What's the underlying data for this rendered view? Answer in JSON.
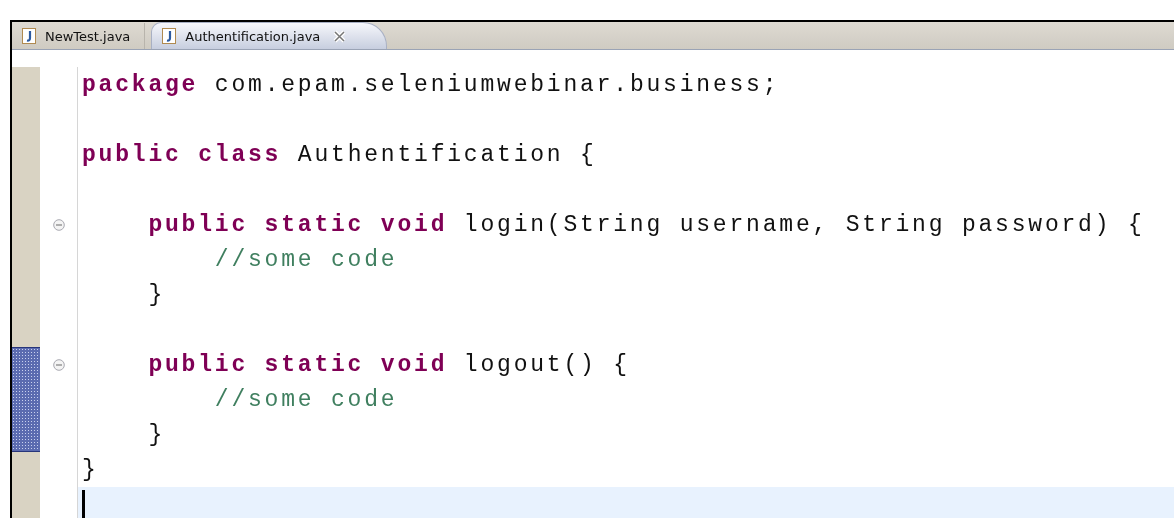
{
  "tabs": [
    {
      "label": "NewTest.java",
      "selected": false
    },
    {
      "label": "Authentification.java",
      "selected": true
    }
  ],
  "lines": [
    {
      "kind": "code",
      "tokens": [
        {
          "kind": "keyword",
          "text": "package"
        },
        {
          "kind": "plain",
          "text": " com.epam.seleniumwebinar.business;"
        }
      ]
    },
    {
      "kind": "blank"
    },
    {
      "kind": "code",
      "tokens": [
        {
          "kind": "keyword",
          "text": "public class"
        },
        {
          "kind": "plain",
          "text": " Authentification {"
        }
      ],
      "children": [
        {
          "kind": "blank"
        },
        {
          "kind": "code",
          "foldable": true,
          "expanded": true,
          "tokens": [
            {
              "kind": "keyword",
              "text": "public static void"
            },
            {
              "kind": "plain",
              "text": " login(String username, String password) {"
            }
          ],
          "children": [
            {
              "kind": "code",
              "tokens": [
                {
                  "kind": "comment",
                  "text": "//some code"
                }
              ]
            }
          ]
        },
        {
          "kind": "code",
          "tokens": [
            {
              "kind": "plain",
              "text": "}"
            }
          ]
        },
        {
          "kind": "blank"
        },
        {
          "kind": "code",
          "foldable": true,
          "expanded": true,
          "in_range": true,
          "tokens": [
            {
              "kind": "keyword",
              "text": "public static void"
            },
            {
              "kind": "plain",
              "text": " logout() {"
            }
          ],
          "children": [
            {
              "kind": "code",
              "in_range": true,
              "tokens": [
                {
                  "kind": "comment",
                  "text": "//some code"
                }
              ]
            }
          ]
        },
        {
          "kind": "code",
          "in_range": true,
          "tokens": [
            {
              "kind": "plain",
              "text": "}"
            }
          ]
        }
      ]
    },
    {
      "kind": "code",
      "tokens": [
        {
          "kind": "plain",
          "text": "}"
        }
      ]
    },
    {
      "kind": "blank",
      "current": true
    }
  ]
}
